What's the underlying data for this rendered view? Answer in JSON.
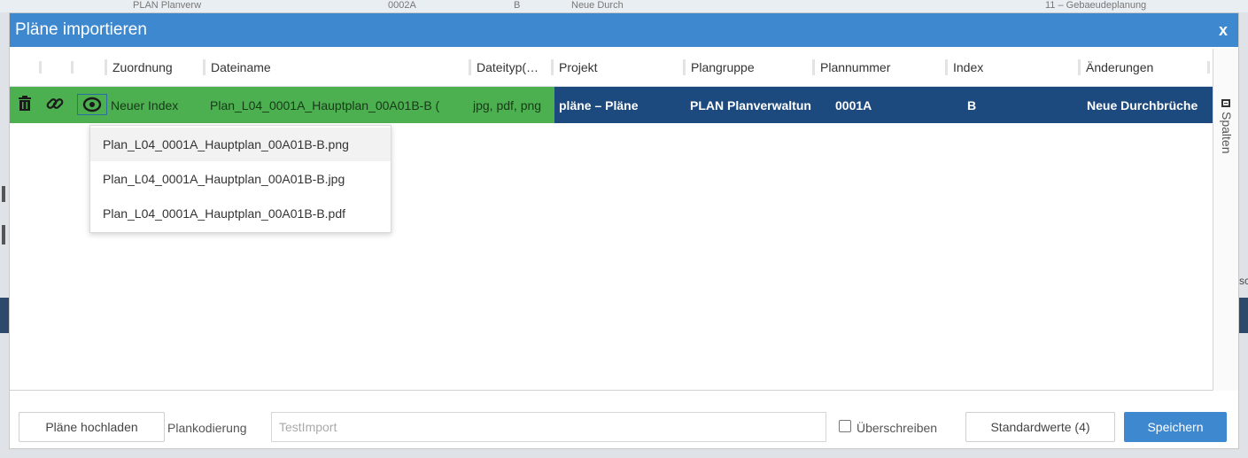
{
  "background": {
    "strip_texts": [
      "PLAN    Planverw",
      "0002A",
      "B",
      "Neue Durch",
      "11 – Gebaeudeplanung"
    ],
    "right_fragment": "sc"
  },
  "dialog": {
    "title": "Pläne importieren",
    "close_label": "x"
  },
  "grid": {
    "columns": [
      "Zuordnung",
      "Dateiname",
      "Dateityp(…",
      "Projekt",
      "Plangruppe",
      "Plannummer",
      "Index",
      "Änderungen"
    ],
    "row": {
      "zuordnung": "Neuer Index",
      "dateiname": "Plan_L04_0001A_Hauptplan_00A01B-B (",
      "dateityp": "jpg, pdf, png",
      "projekt": "pläne – Pläne",
      "plangruppe": "PLAN Planverwaltun",
      "plannummer": "0001A",
      "index": "B",
      "aenderungen": "Neue Durchbrüche"
    },
    "side_panel_label": "Spalten",
    "colors": {
      "row_green": "#4caf50",
      "row_blue": "#1c4a7e",
      "header_bar": "#3e88cf"
    }
  },
  "file_dropdown": {
    "items": [
      "Plan_L04_0001A_Hauptplan_00A01B-B.png",
      "Plan_L04_0001A_Hauptplan_00A01B-B.jpg",
      "Plan_L04_0001A_Hauptplan_00A01B-B.pdf"
    ]
  },
  "footer": {
    "upload_button": "Pläne hochladen",
    "coding_label": "Plankodierung",
    "coding_placeholder": "TestImport",
    "overwrite_label": "Überschreiben",
    "defaults_button": "Standardwerte (4)",
    "save_button": "Speichern"
  }
}
